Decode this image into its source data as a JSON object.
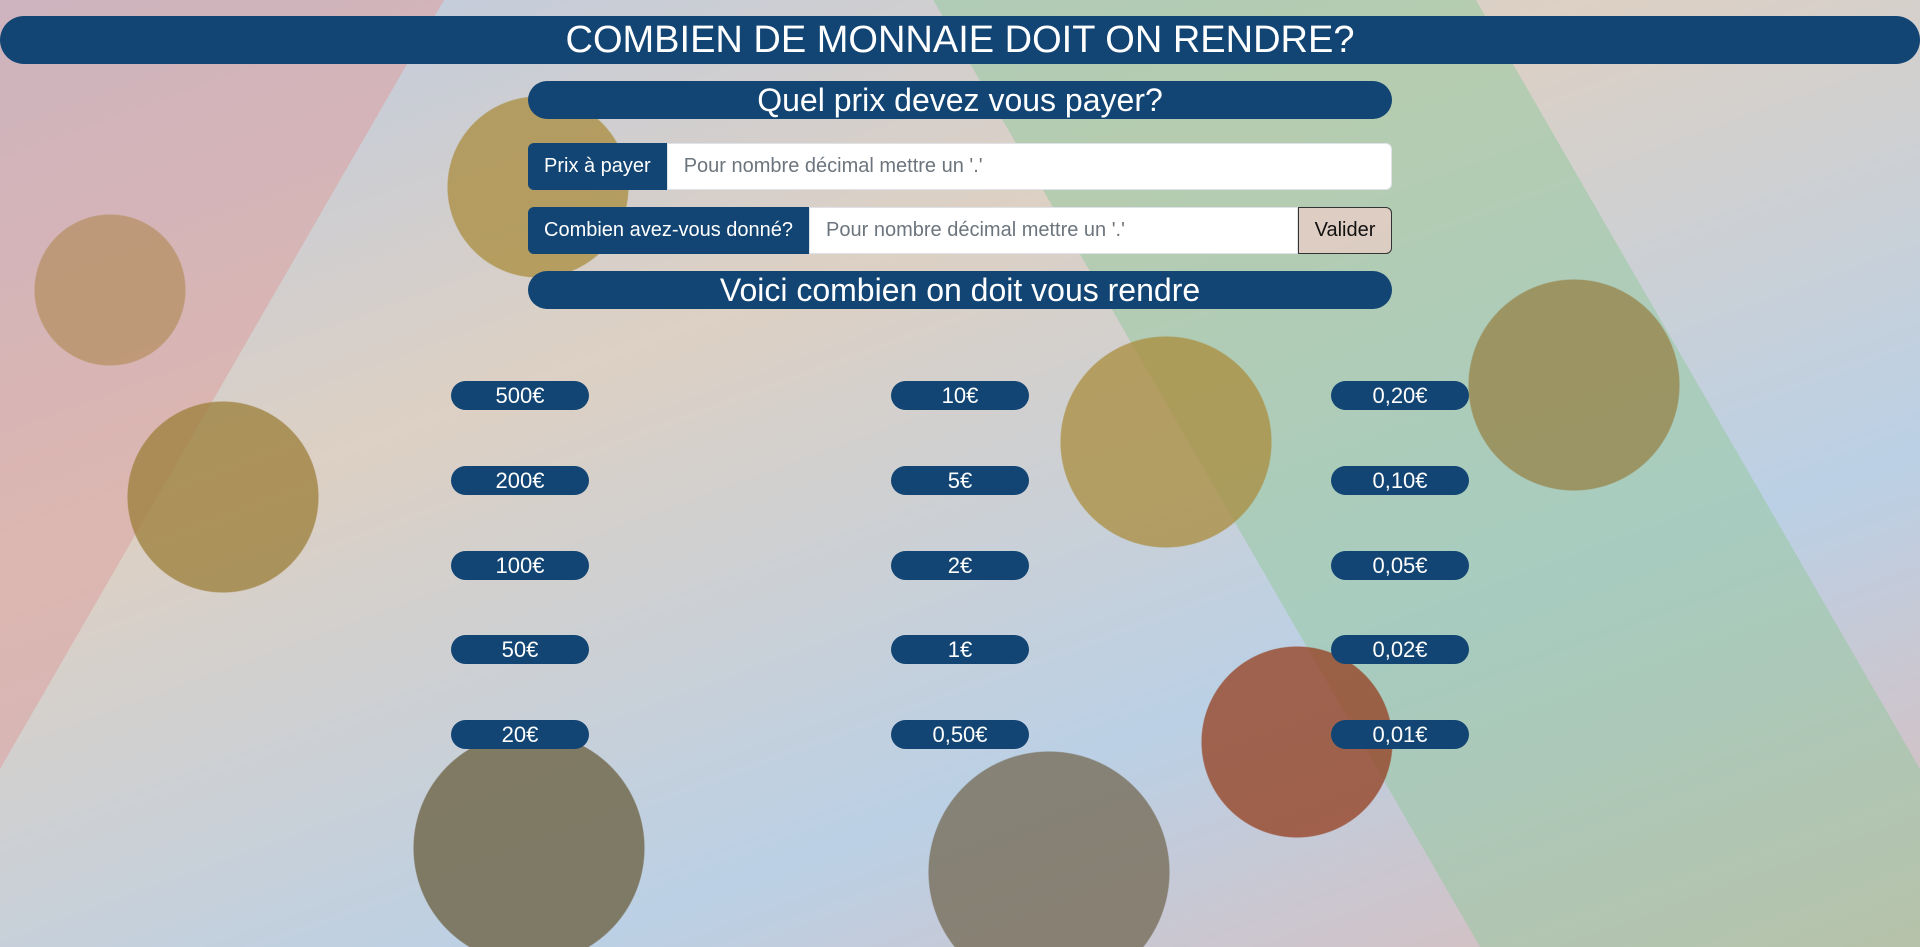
{
  "header": {
    "title": "COMBIEN DE MONNAIE DOIT ON RENDRE?"
  },
  "price_section": {
    "heading": "Quel prix devez vous payer?"
  },
  "form": {
    "price_label": "Prix à payer",
    "price_placeholder": "Pour nombre décimal mettre un '.'",
    "given_label": "Combien avez-vous donné?",
    "given_placeholder": "Pour nombre décimal mettre un '.'",
    "submit_label": "Valider"
  },
  "result_section": {
    "heading": "Voici combien on doit vous rendre"
  },
  "denominations": {
    "col1": [
      "500€",
      "200€",
      "100€",
      "50€",
      "20€"
    ],
    "col2": [
      "10€",
      "5€",
      "2€",
      "1€",
      "0,50€"
    ],
    "col3": [
      "0,20€",
      "0,10€",
      "0,05€",
      "0,02€",
      "0,01€"
    ]
  },
  "colors": {
    "accent": "#124573",
    "text_on_accent": "#ffffff"
  }
}
